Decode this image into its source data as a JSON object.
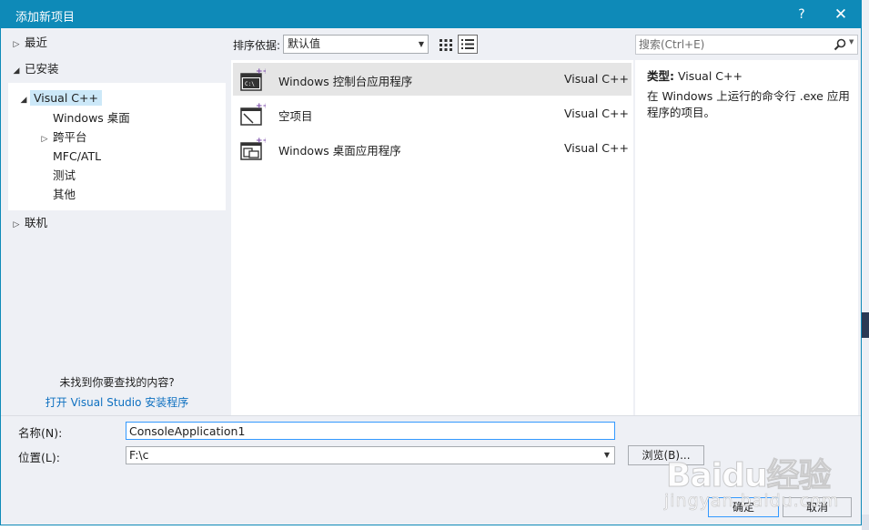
{
  "dialog": {
    "title": "添加新项目",
    "help_label": "?",
    "close_label": "✕"
  },
  "tree": {
    "recent": "最近",
    "installed": "已安装",
    "visual_cpp": "Visual C++",
    "children": [
      "Windows 桌面",
      "跨平台",
      "MFC/ATL",
      "测试",
      "其他"
    ],
    "online": "联机",
    "not_found": "未找到你要查找的内容?",
    "open_installer": "打开 Visual Studio 安装程序"
  },
  "sort": {
    "label": "排序依据:",
    "value": "默认值"
  },
  "search": {
    "placeholder": "搜索(Ctrl+E)"
  },
  "templates": [
    {
      "name": "Windows 控制台应用程序",
      "lang": "Visual C++",
      "icon": "console-app-icon"
    },
    {
      "name": "空项目",
      "lang": "Visual C++",
      "icon": "empty-project-icon"
    },
    {
      "name": "Windows 桌面应用程序",
      "lang": "Visual C++",
      "icon": "desktop-app-icon"
    }
  ],
  "description": {
    "type_label": "类型:",
    "type_value": "Visual C++",
    "text": "在 Windows 上运行的命令行 .exe 应用程序的项目。"
  },
  "form": {
    "name_label": "名称(N):",
    "name_value": "ConsoleApplication1",
    "location_label": "位置(L):",
    "location_value": "F:\\c",
    "browse_label": "浏览(B)...",
    "ok_label": "确定",
    "cancel_label": "取消"
  },
  "watermark": {
    "brand": "Baidu经验",
    "url": "jingyan.baidu.com"
  },
  "colors": {
    "accent": "#0e8ab8",
    "selection": "#cce8f8",
    "link": "#0e70c0"
  }
}
